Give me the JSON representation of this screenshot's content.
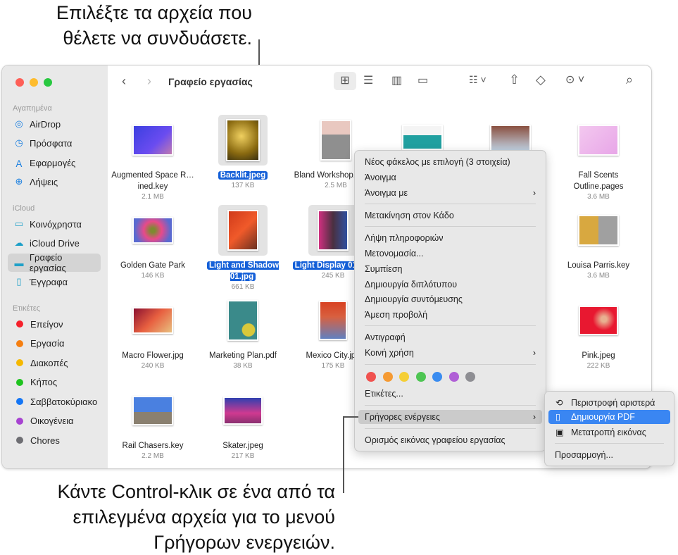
{
  "callouts": {
    "top": [
      "Επιλέξτε τα αρχεία που",
      "θέλετε να συνδυάσετε."
    ],
    "bottom": [
      "Κάντε Control-κλικ σε ένα από τα",
      "επιλεγμένα αρχεία για το μενού",
      "Γρήγορων ενεργειών."
    ]
  },
  "sidebar": {
    "favorites_label": "Αγαπημένα",
    "favorites": [
      {
        "label": "AirDrop",
        "icon": "airdrop-icon"
      },
      {
        "label": "Πρόσφατα",
        "icon": "clock-icon"
      },
      {
        "label": "Εφαρμογές",
        "icon": "applications-icon"
      },
      {
        "label": "Λήψεις",
        "icon": "download-icon"
      }
    ],
    "icloud_label": "iCloud",
    "icloud": [
      {
        "label": "Κοινόχρηστα",
        "icon": "shared-folder-icon"
      },
      {
        "label": "iCloud Drive",
        "icon": "cloud-icon"
      },
      {
        "label": "Γραφείο εργασίας",
        "icon": "desktop-icon",
        "selected": true
      },
      {
        "label": "Έγγραφα",
        "icon": "document-icon"
      }
    ],
    "tags_label": "Ετικέτες",
    "tags": [
      {
        "label": "Επείγον",
        "color": "#f5212b"
      },
      {
        "label": "Εργασία",
        "color": "#f57f11"
      },
      {
        "label": "Διακοπές",
        "color": "#f5b800"
      },
      {
        "label": "Κήπος",
        "color": "#1ec31e"
      },
      {
        "label": "Σαββατοκύριακο",
        "color": "#1476f5"
      },
      {
        "label": "Οικογένεια",
        "color": "#a743d1"
      },
      {
        "label": "Chores",
        "color": "#6e6e73"
      }
    ]
  },
  "toolbar": {
    "title": "Γραφείο εργασίας"
  },
  "files": [
    {
      "name": "Augmented Space R…ined.key",
      "size": "2.1 MB"
    },
    {
      "name": "Backlit.jpeg",
      "size": "137 KB",
      "selected": true
    },
    {
      "name": "Bland Workshop.pages",
      "size": "2.5 MB"
    },
    {
      "name": "Fall Scents Outline.pages",
      "size": "3.6 MB"
    },
    {
      "name": "Golden Gate Park",
      "size": "146 KB"
    },
    {
      "name": "Light and Shadow 01.jpg",
      "size": "661 KB",
      "selected": true
    },
    {
      "name": "Light Display 01.jpg",
      "size": "245 KB",
      "selected": true
    },
    {
      "name": "Louisa Parris.key",
      "size": "3.6 MB"
    },
    {
      "name": "Macro Flower.jpg",
      "size": "240 KB"
    },
    {
      "name": "Marketing Plan.pdf",
      "size": "38 KB"
    },
    {
      "name": "Mexico City.jpg",
      "size": "175 KB"
    },
    {
      "name": "Pink.jpeg",
      "size": "222 KB"
    },
    {
      "name": "Rail Chasers.key",
      "size": "2.2 MB"
    },
    {
      "name": "Skater.jpeg",
      "size": "217 KB"
    }
  ],
  "context_menu": {
    "items": [
      "Νέος φάκελος με επιλογή (3 στοιχεία)",
      "Άνοιγμα",
      "Άνοιγμα με",
      "Μετακίνηση στον Κάδο",
      "Λήψη πληροφοριών",
      "Μετονομασία...",
      "Συμπίεση",
      "Δημιουργία διπλότυπου",
      "Δημιουργία συντόμευσης",
      "Άμεση προβολή",
      "Αντιγραφή",
      "Κοινή χρήση",
      "Ετικέτες...",
      "Γρήγορες ενέργειες",
      "Ορισμός εικόνας γραφείου εργασίας"
    ],
    "tag_colors": [
      "#f0524f",
      "#f59a33",
      "#f5cf36",
      "#4ec553",
      "#3a8cf0",
      "#b05fd6",
      "#8e8e93"
    ]
  },
  "submenu": {
    "items": [
      "Περιστροφή αριστερά",
      "Δημιουργία PDF",
      "Μετατροπή εικόνας",
      "Προσαρμογή..."
    ],
    "highlighted": "Δημιουργία PDF"
  }
}
